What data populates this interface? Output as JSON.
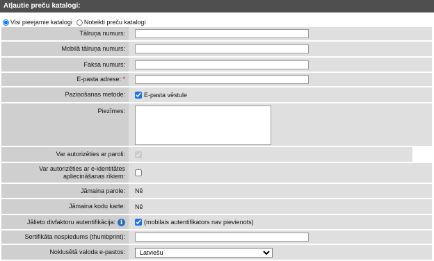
{
  "header": {
    "title": "Atļautie preču katalogi:"
  },
  "catalogs": {
    "option_all": "Visi pieejamie katalogi",
    "option_custom": "Noteikti preču katalogi",
    "selected": "all"
  },
  "fields": {
    "phone": {
      "label": "Tālruņa numurs:",
      "value": ""
    },
    "mobile": {
      "label": "Mobilā tālruņa numurs:",
      "value": ""
    },
    "fax": {
      "label": "Faksa numurs:",
      "value": ""
    },
    "email": {
      "label": "E-pasta adrese:",
      "required_mark": "*",
      "value": ""
    },
    "notify": {
      "label": "Paziņošanas metode:",
      "option": "E-pasta vēstule",
      "checked": true
    },
    "notes": {
      "label": "Piezīmes:",
      "value": ""
    },
    "auth_password": {
      "label": "Var autorizēties ar paroli:",
      "checked": true,
      "disabled": true
    },
    "auth_eid": {
      "label": "Var autorizēties ar e-identitātes apliecināšanas rīkiem:",
      "checked": false
    },
    "change_password": {
      "label": "Jāmaina parole:",
      "value": "Nē"
    },
    "change_codecard": {
      "label": "Jāmaina kodu karte:",
      "value": "Nē"
    },
    "twofa": {
      "label": "Jālieto divfaktoru autentifikācija:",
      "info_icon": "info-icon",
      "checked": true,
      "note": "(mobilais autentifikators nav pievienots)"
    },
    "thumbprint": {
      "label": "Sertifikāta nospiedums (thumbprint):",
      "value": ""
    },
    "language": {
      "label": "Noklusētā valoda e-pastos:",
      "selected": "Latviešu"
    }
  }
}
